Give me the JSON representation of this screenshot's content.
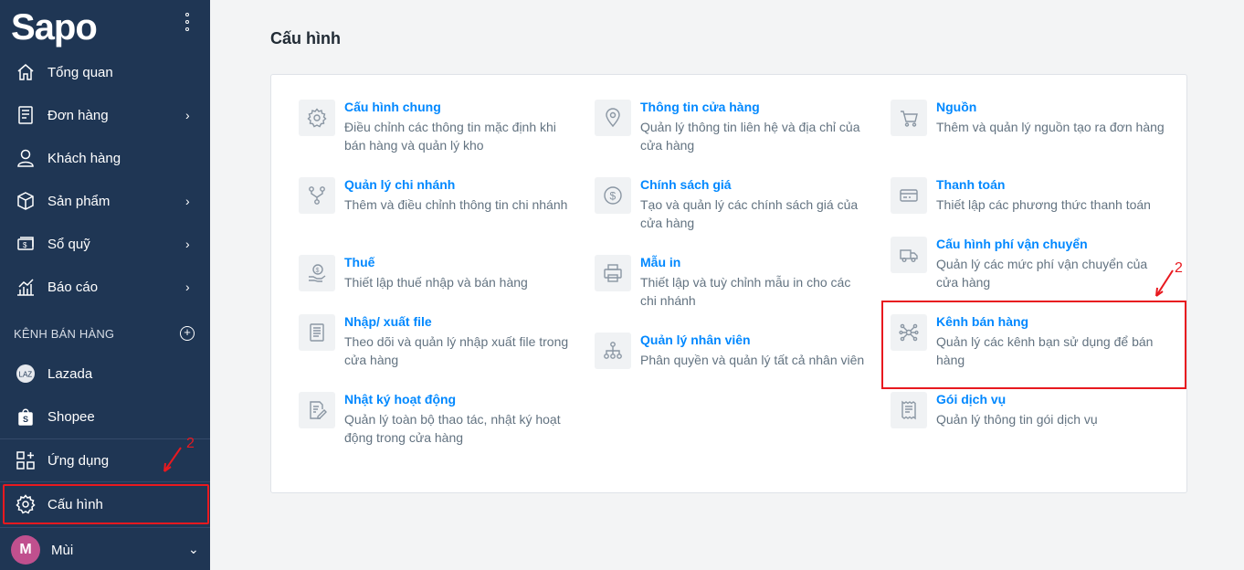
{
  "sidebar": {
    "logo": "Sapo",
    "items": [
      {
        "label": "Tổng quan"
      },
      {
        "label": "Đơn hàng"
      },
      {
        "label": "Khách hàng"
      },
      {
        "label": "Sản phẩm"
      },
      {
        "label": "Sổ quỹ"
      },
      {
        "label": "Báo cáo"
      }
    ],
    "section_title": "KÊNH BÁN HÀNG",
    "channels": [
      {
        "label": "Lazada"
      },
      {
        "label": "Shopee"
      }
    ],
    "apps_label": "Ứng dụng",
    "settings_label": "Cấu hình",
    "user": {
      "initial": "M",
      "name": "Mùi"
    }
  },
  "main": {
    "title": "Cấu hình",
    "items": [
      {
        "title": "Cấu hình chung",
        "desc": "Điều chỉnh các thông tin mặc định khi bán hàng và quản lý kho"
      },
      {
        "title": "Thông tin cửa hàng",
        "desc": "Quản lý thông tin liên hệ và địa chỉ của cửa hàng"
      },
      {
        "title": "Nguồn",
        "desc": "Thêm và quản lý nguồn tạo ra đơn hàng"
      },
      {
        "title": "Quản lý chi nhánh",
        "desc": "Thêm và điều chỉnh thông tin chi nhánh"
      },
      {
        "title": "Chính sách giá",
        "desc": "Tạo và quản lý các chính sách giá của cửa hàng"
      },
      {
        "title": "Thanh toán",
        "desc": "Thiết lập các phương thức thanh toán"
      },
      {
        "title": "Thuế",
        "desc": "Thiết lập thuế nhập và bán hàng"
      },
      {
        "title": "Mẫu in",
        "desc": "Thiết lập và tuỳ chỉnh mẫu in cho các chi nhánh"
      },
      {
        "title": "Cấu hình phí vận chuyển",
        "desc": "Quản lý các mức phí vận chuyển của cửa hàng"
      },
      {
        "title": "Nhập/ xuất file",
        "desc": "Theo dõi và quản lý nhập xuất file trong cửa hàng"
      },
      {
        "title": "Quản lý nhân viên",
        "desc": "Phân quyền và quản lý tất cả nhân viên"
      },
      {
        "title": "Kênh bán hàng",
        "desc": "Quản lý các kênh bạn sử dụng để bán hàng"
      },
      {
        "title": "Nhật ký hoạt động",
        "desc": "Quản lý toàn bộ thao tác, nhật ký hoạt động trong cửa hàng"
      },
      {
        "title": "Gói dịch vụ",
        "desc": "Quản lý thông tin gói dịch vụ"
      }
    ]
  },
  "annotations": {
    "sidebar_step": "2",
    "card_step": "2"
  },
  "colors": {
    "sidebar_bg": "#1f3654",
    "link": "#0088ff",
    "highlight": "#e8191f"
  }
}
